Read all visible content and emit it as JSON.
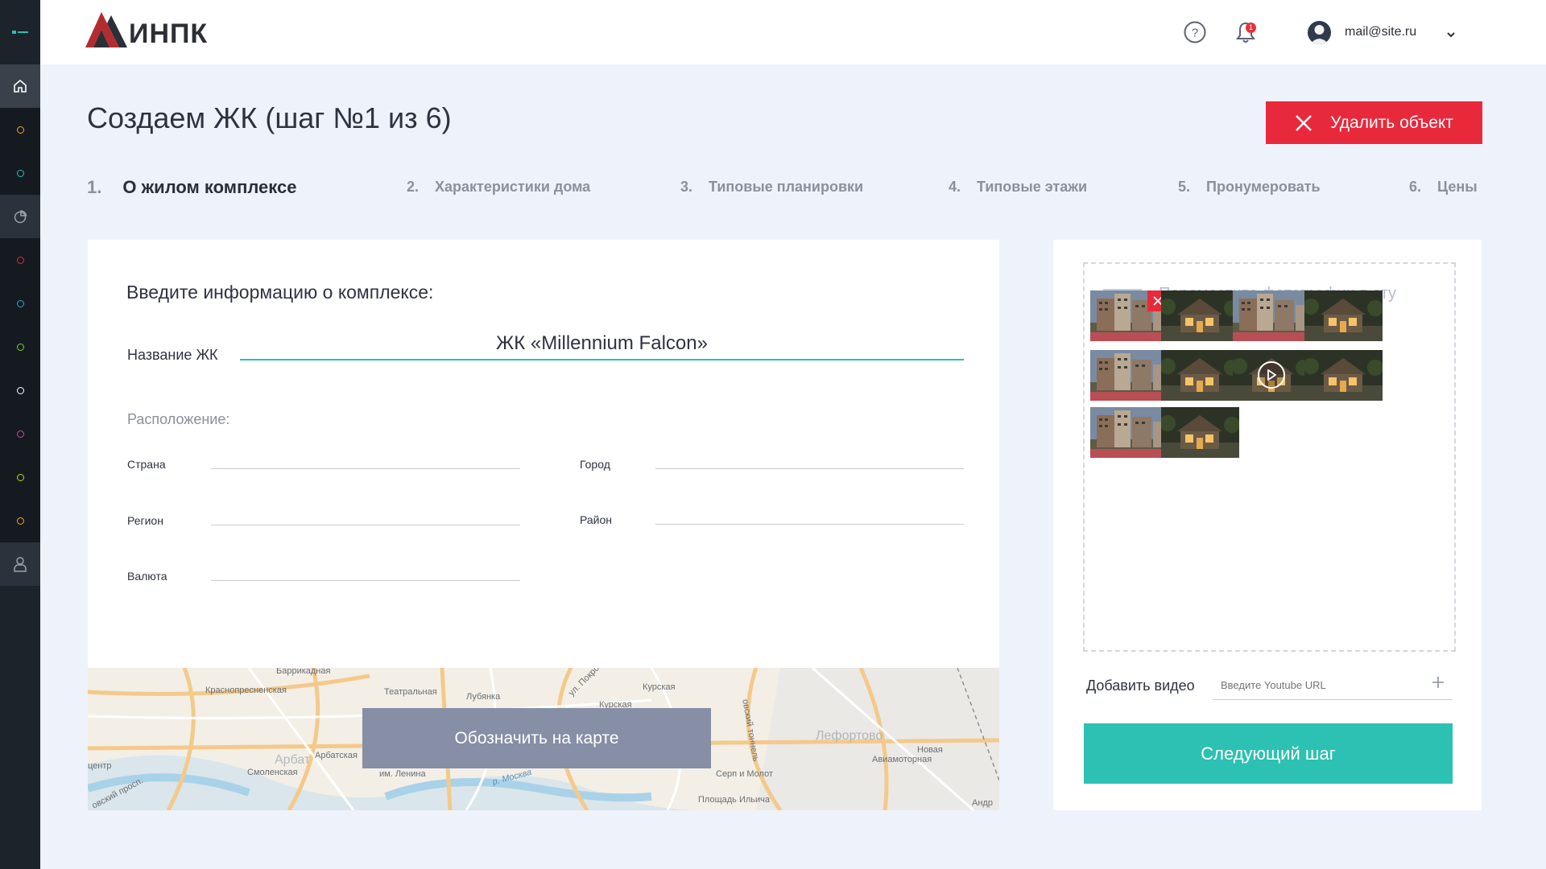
{
  "header": {
    "logo_text": "ИНПК",
    "notifications_count": "1",
    "user_email": "mail@site.ru"
  },
  "sidebar": {
    "dot_colors": [
      "#f5a623",
      "#2bbfb3",
      "#e8293b",
      "#2aa6c7",
      "#7ed321",
      "#ffffff",
      "#d0449b",
      "#b8d429",
      "#f5a623"
    ]
  },
  "page": {
    "title": "Создаем ЖК (шаг №1 из 6)",
    "delete_label": "Удалить объект"
  },
  "steps": [
    {
      "num": "1.",
      "label": "О жилом комплексе"
    },
    {
      "num": "2.",
      "label": "Характеристики дома"
    },
    {
      "num": "3.",
      "label": "Типовые планировки"
    },
    {
      "num": "4.",
      "label": "Типовые этажи"
    },
    {
      "num": "5.",
      "label": "Пронумеровать"
    },
    {
      "num": "6.",
      "label": "Цены"
    }
  ],
  "form": {
    "intro": "Введите информацию о комплексе:",
    "name_label": "Название ЖК",
    "name_value": "ЖК «Millennium Falcon»",
    "location_title": "Расположение:",
    "country_label": "Страна",
    "city_label": "Город",
    "region_label": "Регион",
    "district_label": "Район",
    "currency_label": "Валюта"
  },
  "map": {
    "button_label": "Обозначить на карте",
    "labels": [
      "Баррикадная",
      "Краснопресненская",
      "Театральная",
      "Лубянка",
      "ул. Покро",
      "Курская",
      "Курская",
      "Арбатская",
      "Арбат",
      "Смоленская",
      "им. Ленина",
      "р. Москва",
      "Серп и Молот",
      "Площадь Ильича",
      "Лефортово",
      "Авиамоторная",
      "Новая",
      "центр",
      "овский просп.",
      "овский тоннель",
      "Андр"
    ]
  },
  "media": {
    "dropzone_text": "Переместите фотографии в эту область либо нажмите тут",
    "video_label": "Добавить видео",
    "video_placeholder": "Введите Youtube URL",
    "next_label": "Следующий шаг"
  }
}
